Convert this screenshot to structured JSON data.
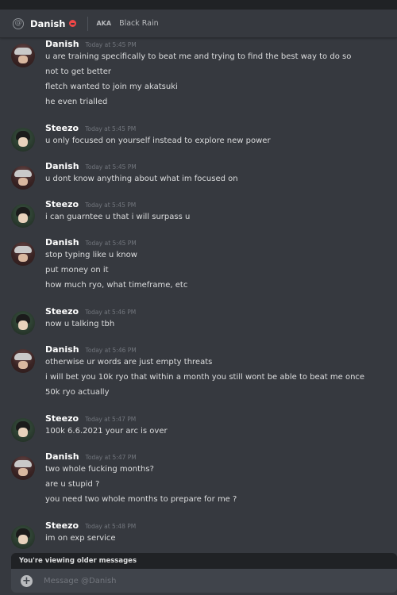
{
  "header": {
    "name": "Danish",
    "aka_label": "AKA",
    "aka_name": "Black Rain"
  },
  "messages": [
    {
      "author": "Danish",
      "timestamp": "Today at 5:45 PM",
      "lines": [
        "u are training specifically to beat me and trying to find the best way to do so",
        "not to get better",
        "fletch wanted to join my akatsuki",
        "he even trialled"
      ]
    },
    {
      "author": "Steezo",
      "timestamp": "Today at 5:45 PM",
      "lines": [
        "u only focused on yourself instead to explore new power"
      ]
    },
    {
      "author": "Danish",
      "timestamp": "Today at 5:45 PM",
      "lines": [
        "u dont know anything about what im focused on"
      ]
    },
    {
      "author": "Steezo",
      "timestamp": "Today at 5:45 PM",
      "lines": [
        "i can guarntee u that i will surpass u"
      ]
    },
    {
      "author": "Danish",
      "timestamp": "Today at 5:45 PM",
      "lines": [
        "stop typing like u know",
        "put money on it",
        "how much ryo, what timeframe, etc"
      ]
    },
    {
      "author": "Steezo",
      "timestamp": "Today at 5:46 PM",
      "lines": [
        "now u talking tbh"
      ]
    },
    {
      "author": "Danish",
      "timestamp": "Today at 5:46 PM",
      "lines": [
        "otherwise ur words are just empty threats",
        "i will bet you 10k ryo that within a month you still wont be able to beat me once",
        "50k ryo actually"
      ]
    },
    {
      "author": "Steezo",
      "timestamp": "Today at 5:47 PM",
      "lines": [
        "100k  6.6.2021 your arc is over"
      ]
    },
    {
      "author": "Danish",
      "timestamp": "Today at 5:47 PM",
      "lines": [
        "two whole fucking months?",
        "are u stupid ?",
        "you need two whole months to prepare for me ?"
      ]
    },
    {
      "author": "Steezo",
      "timestamp": "Today at 5:48 PM",
      "lines": [
        "im on exp service"
      ]
    }
  ],
  "older_notice": "You're viewing older messages",
  "composer": {
    "placeholder": "Message @Danish",
    "value": ""
  },
  "colors": {
    "background": "#36393f",
    "header_bg": "#36393f",
    "dnd_status": "#f04747",
    "composer_bg": "#40444b",
    "notice_bg": "#202225",
    "timestamp": "#72767d"
  },
  "icons": [
    "at-icon",
    "dnd-status-icon",
    "add-attachment-icon"
  ]
}
